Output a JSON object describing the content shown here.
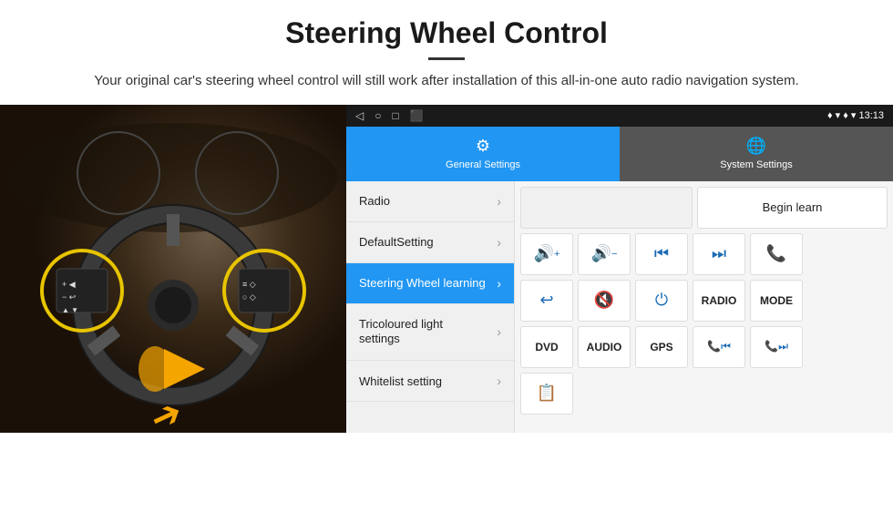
{
  "header": {
    "title": "Steering Wheel Control",
    "divider": true,
    "subtitle": "Your original car's steering wheel control will still work after installation of this all-in-one auto radio navigation system."
  },
  "statusBar": {
    "leftIcons": [
      "◁",
      "○",
      "□",
      "⬛"
    ],
    "rightItems": "♦ ▾  13:13"
  },
  "tabs": [
    {
      "id": "general",
      "label": "General Settings",
      "icon": "⚙",
      "active": true
    },
    {
      "id": "system",
      "label": "System Settings",
      "icon": "🌐",
      "active": false
    }
  ],
  "menu": [
    {
      "id": "radio",
      "label": "Radio",
      "active": false
    },
    {
      "id": "default",
      "label": "DefaultSetting",
      "active": false
    },
    {
      "id": "steering",
      "label": "Steering Wheel learning",
      "active": true
    },
    {
      "id": "tricolour",
      "label": "Tricoloured light settings",
      "active": false,
      "multiline": true
    },
    {
      "id": "whitelist",
      "label": "Whitelist setting",
      "active": false
    }
  ],
  "buttonGrid": {
    "row1": {
      "empty": true,
      "buttons": [
        "Begin learn"
      ]
    },
    "row2": {
      "buttons": [
        "🔊+",
        "🔊−",
        "⏮",
        "⏭",
        "📞"
      ]
    },
    "row3": {
      "buttons": [
        "↩",
        "🔇",
        "⏻",
        "RADIO",
        "MODE"
      ]
    },
    "row4": {
      "buttons": [
        "DVD",
        "AUDIO",
        "GPS",
        "📞⏮",
        "📞⏭"
      ]
    },
    "row5": {
      "buttons": [
        "📋"
      ]
    }
  }
}
